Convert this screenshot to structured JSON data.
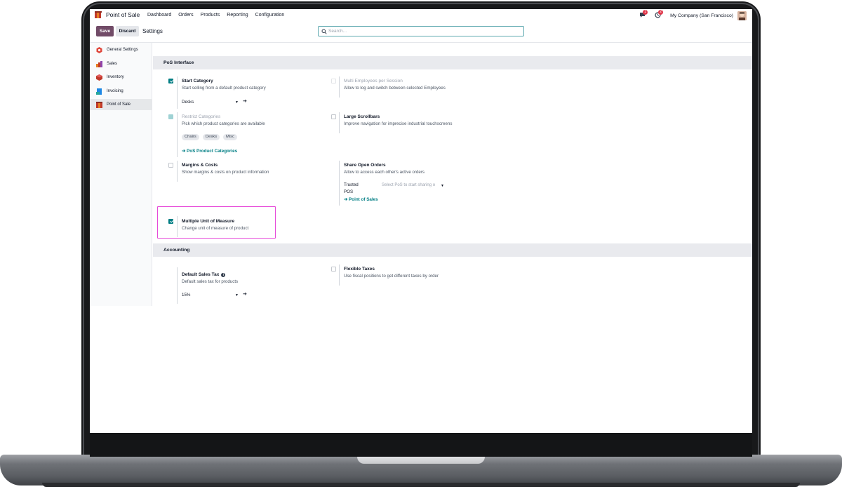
{
  "app": {
    "name": "Point of Sale"
  },
  "nav": {
    "menu": [
      "Dashboard",
      "Orders",
      "Products",
      "Reporting",
      "Configuration"
    ]
  },
  "navbar_right": {
    "messages_count": "1",
    "activities_count": "2",
    "company": "My Company (San Francisco)"
  },
  "control": {
    "save_label": "Save",
    "discard_label": "Discard",
    "title": "Settings",
    "search_placeholder": "Search..."
  },
  "sidebar": {
    "items": [
      {
        "label": "General Settings",
        "icon": "settings-hexagon-icon"
      },
      {
        "label": "Sales",
        "icon": "sales-chart-icon"
      },
      {
        "label": "Inventory",
        "icon": "inventory-box-icon"
      },
      {
        "label": "Invoicing",
        "icon": "invoicing-doc-icon"
      },
      {
        "label": "Point of Sale",
        "icon": "pos-shop-icon"
      }
    ]
  },
  "sections": {
    "pos_interface": "PoS Interface",
    "accounting": "Accounting"
  },
  "settings": {
    "start_category": {
      "title": "Start Category",
      "desc": "Start selling from a default product category",
      "value": "Desks",
      "checked": true
    },
    "multi_employees": {
      "title": "Multi Employees per Session",
      "desc": "Allow to log and switch between selected Employees",
      "checked": false
    },
    "restrict_categories": {
      "title": "Restrict Categories",
      "desc": "Pick which product categories are available",
      "tags": [
        "Chairs",
        "Desks",
        "Misc"
      ],
      "link": "PoS Product Categories",
      "checked": true
    },
    "large_scrollbars": {
      "title": "Large Scrollbars",
      "desc": "Improve navigation for imprecise industrial touchscreens",
      "checked": false
    },
    "margins_costs": {
      "title": "Margins & Costs",
      "desc": "Show margins & costs on product information",
      "checked": false
    },
    "share_open_orders": {
      "title": "Share Open Orders",
      "desc": "Allow to access each other's active orders",
      "trusted_label_1": "Trusted",
      "trusted_label_2": "POS",
      "trusted_placeholder": "Select PoS to start sharing o",
      "link": "Point of Sales"
    },
    "multiple_uom": {
      "title": "Multiple Unit of Measure",
      "desc": "Change unit of measure of product",
      "checked": true
    },
    "default_sales_tax": {
      "title": "Default Sales Tax",
      "desc": "Default sales tax for products",
      "value": "15%"
    },
    "flexible_taxes": {
      "title": "Flexible Taxes",
      "desc": "Use fiscal positions to get different taxes by order",
      "checked": false
    }
  },
  "colors": {
    "accent": "#017e84",
    "brand": "#714b67",
    "highlight": "#e64ad9",
    "badge": "#e0374a"
  }
}
